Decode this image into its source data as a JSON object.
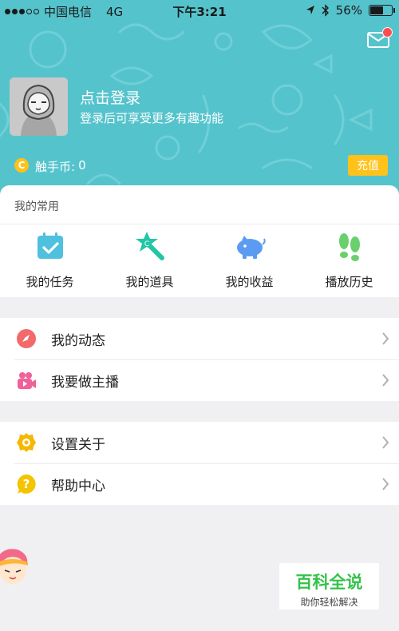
{
  "status_bar": {
    "carrier": "中国电信",
    "network": "4G",
    "time": "下午3:21",
    "battery": "56%",
    "battery_level": 0.56
  },
  "profile": {
    "login_title": "点击登录",
    "login_subtitle": "登录后可享受更多有趣功能",
    "coin_label": "触手币:",
    "coin_value": "0",
    "coin_icon_letter": "C",
    "recharge_label": "充值"
  },
  "favorites": {
    "title": "我的常用",
    "items": [
      {
        "label": "我的任务",
        "icon": "calendar-check-icon"
      },
      {
        "label": "我的道具",
        "icon": "magic-wand-icon"
      },
      {
        "label": "我的收益",
        "icon": "piggy-bank-icon"
      },
      {
        "label": "播放历史",
        "icon": "footprints-icon"
      }
    ]
  },
  "menu_group_1": [
    {
      "label": "我的动态",
      "icon": "compass-icon"
    },
    {
      "label": "我要做主播",
      "icon": "video-camera-icon"
    }
  ],
  "menu_group_2": [
    {
      "label": "设置关于",
      "icon": "settings-gear-icon"
    },
    {
      "label": "帮助中心",
      "icon": "help-icon"
    }
  ],
  "watermark": {
    "title": "百科全说",
    "subtitle": "助你轻松解决"
  },
  "colors": {
    "header_bg": "#55c3cc",
    "accent_yellow": "#ffc21a",
    "green": "#34c24a",
    "coral": "#f26a6a",
    "pink": "#f0619a"
  }
}
